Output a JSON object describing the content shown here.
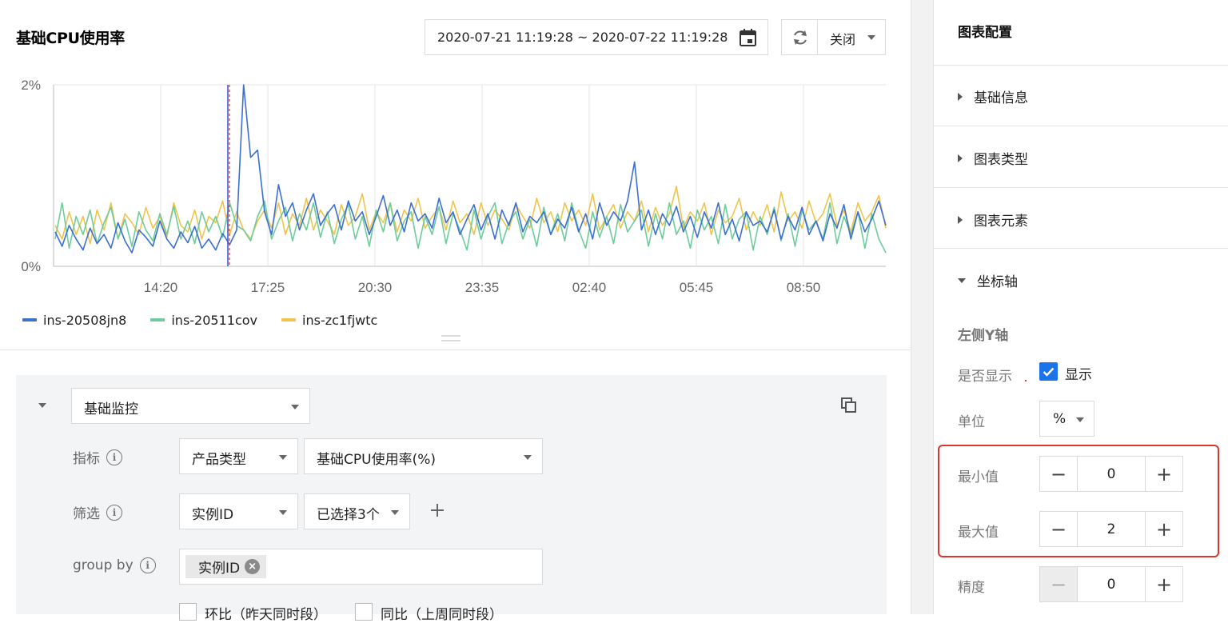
{
  "chart_panel": {
    "title": "基础CPU使用率",
    "date_range": "2020-07-21 11:19:28 ~ 2020-07-22 11:19:28",
    "close_label": "关闭"
  },
  "chart_data": {
    "type": "line",
    "title": "",
    "ylim": [
      0,
      2
    ],
    "y_ticks": [
      "0%",
      "2%"
    ],
    "x_ticks": [
      "14:20",
      "17:25",
      "20:30",
      "23:35",
      "02:40",
      "05:45",
      "08:50"
    ],
    "grid": true,
    "legend_position": "bottom-left",
    "series": [
      {
        "name": "ins-20508jn8",
        "color": "#3b6fd4",
        "values": [
          0.38,
          0.22,
          0.45,
          0.3,
          0.18,
          0.42,
          0.25,
          0.35,
          0.2,
          0.48,
          0.28,
          0.15,
          0.4,
          0.32,
          0.22,
          0.5,
          0.3,
          0.2,
          0.38,
          0.26,
          0.44,
          0.2,
          0.3,
          0.18,
          0.36,
          0.24,
          0.4,
          2.0,
          1.2,
          1.28,
          0.6,
          0.35,
          0.9,
          0.55,
          0.7,
          0.4,
          0.62,
          0.8,
          0.45,
          0.58,
          0.68,
          0.4,
          0.72,
          0.5,
          0.6,
          0.35,
          0.55,
          0.78,
          0.45,
          0.62,
          0.38,
          0.7,
          0.5,
          0.58,
          0.42,
          0.75,
          0.48,
          0.6,
          0.35,
          0.52,
          0.68,
          0.4,
          0.58,
          0.3,
          0.62,
          0.45,
          0.7,
          0.38,
          0.55,
          0.48,
          0.6,
          0.35,
          0.52,
          0.42,
          0.65,
          0.38,
          0.58,
          0.3,
          0.7,
          0.45,
          0.6,
          0.5,
          0.72,
          1.15,
          0.4,
          0.62,
          0.35,
          0.58,
          0.45,
          0.66,
          0.38,
          0.55,
          0.32,
          0.6,
          0.42,
          0.7,
          0.35,
          0.52,
          0.28,
          0.6,
          0.45,
          0.5,
          0.38,
          0.62,
          0.3,
          0.55,
          0.4,
          0.65,
          0.35,
          0.5,
          0.28,
          0.58,
          0.42,
          0.68,
          0.3,
          0.6,
          0.38,
          0.52,
          0.72,
          0.45
        ]
      },
      {
        "name": "ins-20511cov",
        "color": "#6dcc9a",
        "values": [
          0.3,
          0.7,
          0.2,
          0.55,
          0.35,
          0.62,
          0.25,
          0.48,
          0.65,
          0.3,
          0.52,
          0.22,
          0.6,
          0.4,
          0.28,
          0.58,
          0.35,
          0.66,
          0.3,
          0.5,
          0.25,
          0.6,
          0.38,
          0.55,
          0.32,
          0.7,
          0.45,
          0.4,
          0.28,
          0.55,
          0.72,
          0.3,
          0.5,
          0.65,
          0.28,
          0.58,
          0.4,
          0.7,
          0.32,
          0.6,
          0.25,
          0.52,
          0.68,
          0.3,
          0.55,
          0.22,
          0.62,
          0.38,
          0.7,
          0.28,
          0.5,
          0.6,
          0.2,
          0.55,
          0.35,
          0.66,
          0.25,
          0.58,
          0.4,
          0.18,
          0.62,
          0.3,
          0.55,
          0.7,
          0.25,
          0.48,
          0.6,
          0.3,
          0.52,
          0.22,
          0.65,
          0.35,
          0.58,
          0.28,
          0.7,
          0.4,
          0.2,
          0.6,
          0.32,
          0.55,
          0.25,
          0.68,
          0.38,
          0.5,
          0.62,
          0.22,
          0.58,
          0.3,
          0.7,
          0.35,
          0.5,
          0.2,
          0.62,
          0.4,
          0.55,
          0.25,
          0.68,
          0.3,
          0.52,
          0.6,
          0.18,
          0.55,
          0.35,
          0.65,
          0.28,
          0.58,
          0.22,
          0.62,
          0.4,
          0.5,
          0.3,
          0.7,
          0.25,
          0.55,
          0.35,
          0.6,
          0.2,
          0.58,
          0.3,
          0.15
        ]
      },
      {
        "name": "ins-zc1fjwtc",
        "color": "#f0c44c",
        "values": [
          0.45,
          0.3,
          0.6,
          0.35,
          0.55,
          0.25,
          0.62,
          0.4,
          0.7,
          0.3,
          0.58,
          0.48,
          0.35,
          0.65,
          0.42,
          0.55,
          0.32,
          0.7,
          0.45,
          0.38,
          0.62,
          0.3,
          0.55,
          0.48,
          0.72,
          0.35,
          0.6,
          0.4,
          0.3,
          0.5,
          0.62,
          0.42,
          0.7,
          0.35,
          0.58,
          0.45,
          0.75,
          0.4,
          0.62,
          0.5,
          0.35,
          0.68,
          0.45,
          0.55,
          0.8,
          0.4,
          0.6,
          0.48,
          0.7,
          0.38,
          0.62,
          0.5,
          0.75,
          0.42,
          0.55,
          0.65,
          0.4,
          0.72,
          0.48,
          0.58,
          0.35,
          0.7,
          0.45,
          0.62,
          0.52,
          0.4,
          0.68,
          0.55,
          0.42,
          0.75,
          0.48,
          0.6,
          0.38,
          0.7,
          0.5,
          0.62,
          0.45,
          0.8,
          0.4,
          0.55,
          0.68,
          0.42,
          0.6,
          0.5,
          0.72,
          0.38,
          0.65,
          0.45,
          0.58,
          0.88,
          0.42,
          0.6,
          0.5,
          0.7,
          0.35,
          0.62,
          0.48,
          0.55,
          0.75,
          0.4,
          0.6,
          0.45,
          0.68,
          0.38,
          0.82,
          0.5,
          0.6,
          0.42,
          0.72,
          0.48,
          0.58,
          0.8,
          0.45,
          0.62,
          0.38,
          0.7,
          0.5,
          0.6,
          0.78,
          0.42
        ]
      }
    ]
  },
  "query": {
    "source_select": "基础监控",
    "metric_label": "指标",
    "metric_category": "产品类型",
    "metric_name": "基础CPU使用率(%)",
    "filter_label": "筛选",
    "filter_field": "实例ID",
    "filter_value": "已选择3个",
    "groupby_label": "group by",
    "groupby_tag": "实例ID",
    "compare_day": "环比（昨天同时段）",
    "compare_week": "同比（上周同时段）"
  },
  "config": {
    "title": "图表配置",
    "sections": [
      "基础信息",
      "图表类型",
      "图表元素",
      "坐标轴"
    ],
    "left_y_axis": "左侧Y轴",
    "show_label": "是否显示",
    "show_value": "显示",
    "show_checked": true,
    "unit_label": "单位",
    "unit_value": "%",
    "min_label": "最小值",
    "min_value": "0",
    "max_label": "最大值",
    "max_value": "2",
    "precision_label": "精度",
    "precision_value": "0"
  },
  "colors": {
    "accent": "#1a73e8",
    "highlight_box": "#d9372c"
  },
  "icons": [
    "calendar-icon",
    "refresh-icon",
    "copy-icon",
    "info-icon",
    "clear-tag-icon",
    "plus-icon",
    "minus-icon",
    "checkbox-checked-icon"
  ]
}
